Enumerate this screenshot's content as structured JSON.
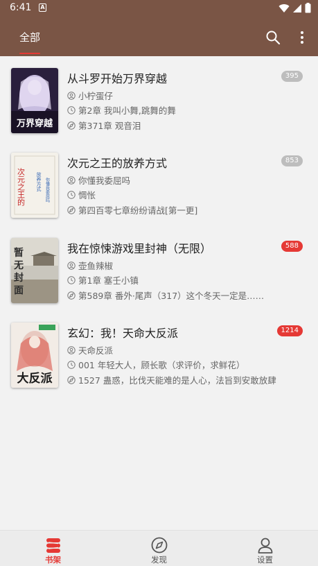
{
  "status_bar": {
    "time": "6:41",
    "notification_letter": "A"
  },
  "app_bar": {
    "tab_label": "全部",
    "accent_color": "#7a5545",
    "indicator_color": "#e53935",
    "icons": [
      "search-icon",
      "more-vert-icon"
    ]
  },
  "books": [
    {
      "title": "从斗罗开始万界穿越",
      "badge": "395",
      "badge_color": "gray",
      "author": "小柠蛋仔",
      "last_read": "第2章 我叫小舞,跳舞的舞",
      "latest": "第371章 观音泪",
      "cover_text": "万界穿越"
    },
    {
      "title": "次元之王的放养方式",
      "badge": "853",
      "badge_color": "gray",
      "author": "你懂我委屈吗",
      "last_read": "惆怅",
      "latest": "第四百零七章纷纷请战[第一更]",
      "cover_text": "次元之王的"
    },
    {
      "title": "我在惊悚游戏里封神（无限）",
      "badge": "588",
      "badge_color": "red",
      "author": "壶鱼辣椒",
      "last_read": "第1章 塞壬小镇",
      "latest": "第589章 番外·尾声（317）这个冬天一定是……",
      "cover_text": "暂无封面"
    },
    {
      "title": "玄幻：我！天命大反派",
      "badge": "1214",
      "badge_color": "red",
      "author": "天命反派",
      "last_read": "001 年轻大人，顾长歌（求评价，求鲜花）",
      "latest": "1527 蛊惑，比伐天能难的是人心，法旨到安敢放肆",
      "cover_text": "大反派"
    }
  ],
  "bottom_nav": {
    "items": [
      {
        "label": "书架",
        "icon": "bookshelf-icon",
        "active": true
      },
      {
        "label": "发现",
        "icon": "compass-icon",
        "active": false
      },
      {
        "label": "设置",
        "icon": "person-icon",
        "active": false
      }
    ]
  }
}
